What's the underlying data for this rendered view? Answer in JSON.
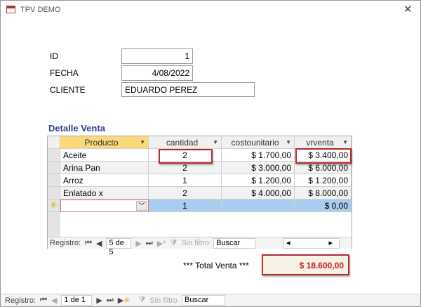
{
  "window": {
    "title": "TPV DEMO",
    "close": "✕"
  },
  "form": {
    "id_label": "ID",
    "id_value": "1",
    "fecha_label": "FECHA",
    "fecha_value": "4/08/2022",
    "cliente_label": "CLIENTE",
    "cliente_value": "EDUARDO PEREZ"
  },
  "detalle": {
    "title": "Detalle Venta",
    "columns": [
      "Producto",
      "cantidad",
      "costounitario",
      "vrventa"
    ],
    "rows": [
      [
        "Aceite",
        "2",
        "$ 1.700,00",
        "$ 3.400,00"
      ],
      [
        "Arina Pan",
        "2",
        "$ 3.000,00",
        "$ 6.000,00"
      ],
      [
        "Arroz",
        "1",
        "$ 1.200,00",
        "$ 1.200,00"
      ],
      [
        "Enlatado x",
        "2",
        "$ 4.000,00",
        "$ 8.000,00"
      ]
    ],
    "new_row": {
      "marker": "✳",
      "cantidad": "1",
      "vrventa": "$ 0,00"
    },
    "nav": {
      "label": "Registro:",
      "position": "5 de 5",
      "filter": "Sin filtro",
      "search": "Buscar"
    }
  },
  "total": {
    "label": "*** Total Venta ***",
    "value": "$ 18.600,00"
  },
  "bottom_nav": {
    "label": "Registro:",
    "position": "1 de 1",
    "filter": "Sin filtro",
    "search": "Buscar"
  },
  "colors": {
    "accent": "#b42a2a",
    "header_selected": "#fbd97a",
    "new_row": "#a9cdee"
  }
}
